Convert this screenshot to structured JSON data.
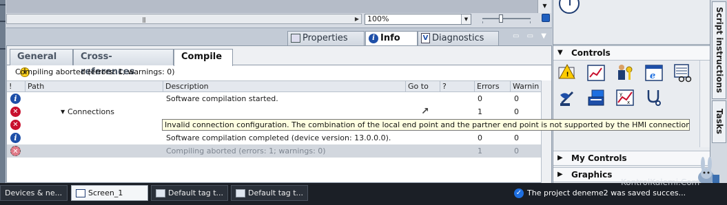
{
  "editor": {
    "zoom": "100%"
  },
  "inspector": {
    "tabs": [
      {
        "label": "Properties",
        "icon": "properties-icon"
      },
      {
        "label": "Info",
        "icon": "info-icon",
        "active": true
      },
      {
        "label": "Diagnostics",
        "icon": "diagnostics-icon"
      }
    ]
  },
  "info": {
    "subtabs": [
      {
        "label": "General",
        "has_warning": true
      },
      {
        "label": "Cross-references"
      },
      {
        "label": "Compile",
        "active": true
      }
    ],
    "summary": "Compiling aborted (errors: 1; warnings: 0)",
    "columns": [
      "!",
      "Path",
      "Description",
      "Go to",
      "?",
      "Errors",
      "Warnin"
    ],
    "rows": [
      {
        "status": "info",
        "path": "",
        "description": "Software compilation started.",
        "errors": "0",
        "warnings": "0"
      },
      {
        "status": "error",
        "path": "Connections",
        "expanded": true,
        "description": "",
        "goto": true,
        "errors": "1",
        "warnings": "0"
      },
      {
        "status": "error",
        "path": "",
        "description": "",
        "errors": "",
        "warnings": ""
      },
      {
        "status": "info",
        "path": "",
        "description": "Software compilation completed (device version: 13.0.0.0).",
        "errors": "0",
        "warnings": "0"
      },
      {
        "status": "error-faded",
        "path": "",
        "description": "Compiling aborted (errors: 1; warnings: 0)",
        "errors": "1",
        "warnings": "0",
        "selected": true
      }
    ],
    "tooltip": "Invalid connection configuration. The combination of the local end point and the partner end point is not supported by the HMI connections."
  },
  "toolbox": {
    "sections": [
      {
        "label": "Controls",
        "expanded": true
      },
      {
        "label": "My Controls",
        "expanded": false
      },
      {
        "label": "Graphics",
        "expanded": false
      }
    ],
    "controls": [
      "alarm-view-icon",
      "trend-view-icon",
      "user-view-icon",
      "browser-icon",
      "recipe-view-icon",
      "sysdiag-icon",
      "media-player-icon",
      "f-x-trend-icon",
      "status-force-icon"
    ]
  },
  "side_tabs": [
    "Script instructions",
    "Tasks"
  ],
  "taskbar": {
    "items": [
      {
        "label": "Devices & ne..."
      },
      {
        "label": "Screen_1",
        "active": true
      },
      {
        "label": "Default tag t..."
      },
      {
        "label": "Default tag t..."
      }
    ],
    "status": "The project deneme2 was saved succes..."
  },
  "watermark": "KontrolKalemi.Com"
}
